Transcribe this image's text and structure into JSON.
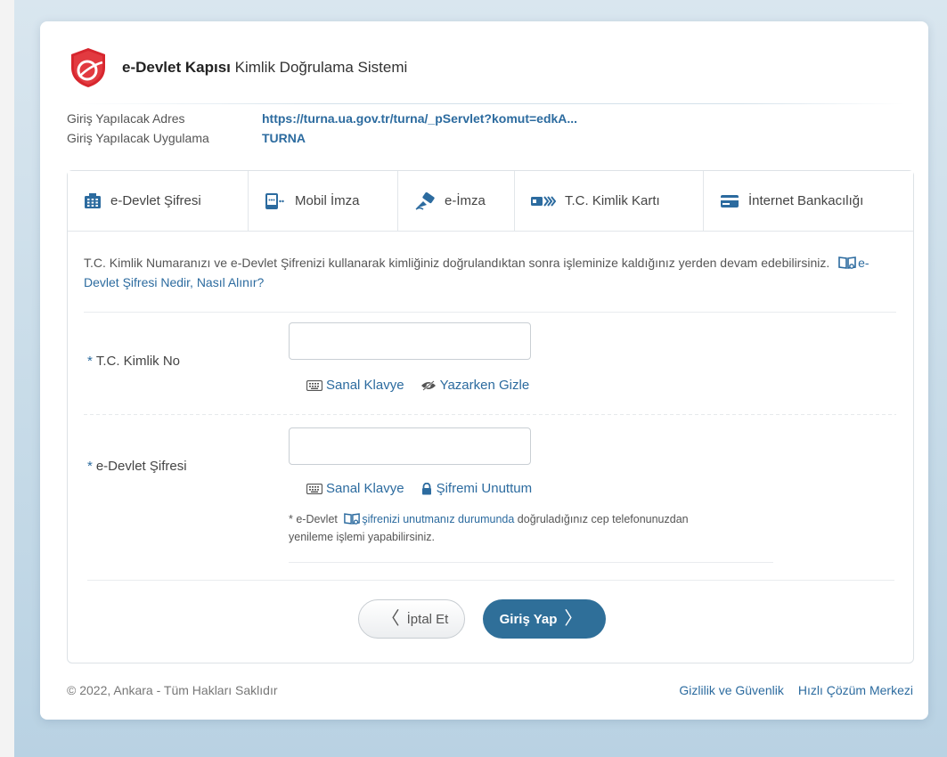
{
  "header": {
    "brand_bold": "e-Devlet Kapısı",
    "brand_rest": "Kimlik Doğrulama Sistemi"
  },
  "info": {
    "address_label": "Giriş Yapılacak Adres",
    "address_value": "https://turna.ua.gov.tr/turna/_pServlet?komut=edkA...",
    "app_label": "Giriş Yapılacak Uygulama",
    "app_value": "TURNA"
  },
  "tabs": [
    {
      "label": "e-Devlet Şifresi",
      "icon": "keypad-icon"
    },
    {
      "label": "Mobil İmza",
      "icon": "mobile-signature-icon"
    },
    {
      "label": "e-İmza",
      "icon": "e-signature-icon"
    },
    {
      "label": "T.C. Kimlik Kartı",
      "icon": "id-card-icon"
    },
    {
      "label": "İnternet Bankacılığı",
      "icon": "credit-card-icon"
    }
  ],
  "description": {
    "text": "T.C. Kimlik Numaranızı ve e-Devlet Şifrenizi kullanarak kimliğiniz doğrulandıktan sonra işleminize kaldığınız yerden devam edebilirsiniz.",
    "help_link": "e-Devlet Şifresi Nedir, Nasıl Alınır?"
  },
  "form": {
    "tc_label": "T.C. Kimlik No",
    "tc_value": "",
    "password_label": "e-Devlet Şifresi",
    "password_value": "",
    "virtual_keyboard": "Sanal Klavye",
    "hide_while_typing": "Yazarken Gizle",
    "forgot_password": "Şifremi Unuttum",
    "note_prefix": "* e-Devlet",
    "note_link": "şifrenizi unutmanız durumunda",
    "note_suffix": "doğruladığınız cep telefonunuzdan yenileme işlemi yapabilirsiniz.",
    "required_mark": "*"
  },
  "buttons": {
    "cancel": "İptal Et",
    "login": "Giriş Yap",
    "cancel_chevron": "〈",
    "login_chevron": "〉"
  },
  "footer": {
    "copyright": "© 2022, Ankara - Tüm Hakları Saklıdır",
    "privacy": "Gizlilik ve Güvenlik",
    "help_center": "Hızlı Çözüm Merkezi"
  },
  "colors": {
    "accent": "#2c6b9f",
    "button_primary": "#2f6f99",
    "logo_red": "#d7262e"
  }
}
